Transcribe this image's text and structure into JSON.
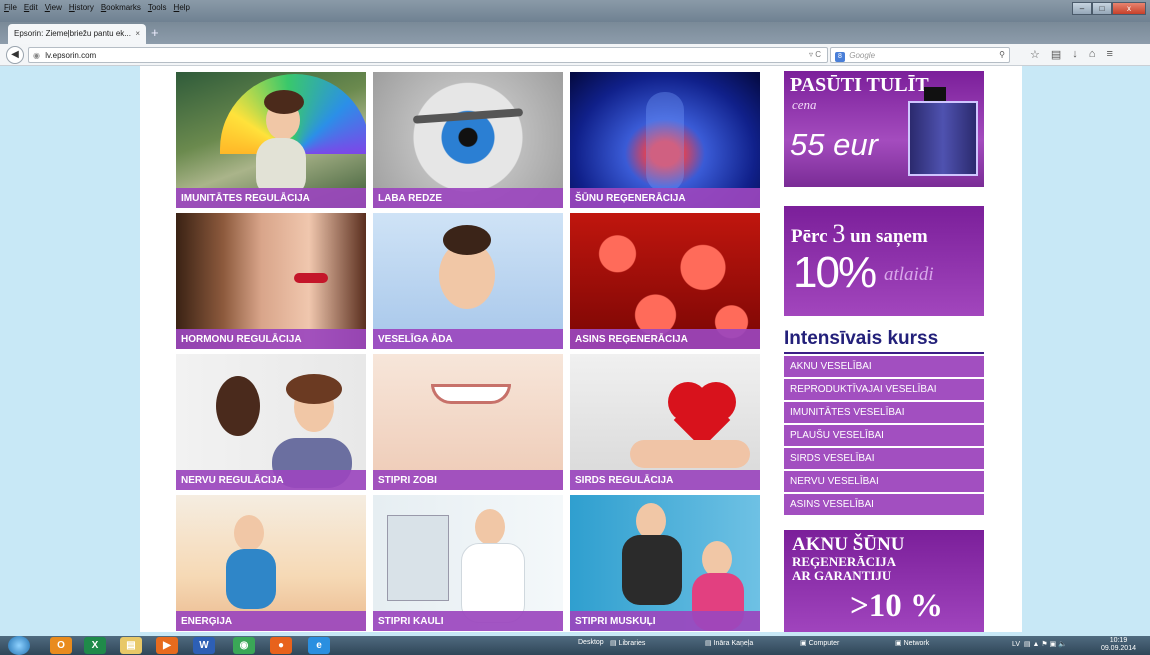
{
  "browser": {
    "menu": [
      "File",
      "Edit",
      "View",
      "History",
      "Bookmarks",
      "Tools",
      "Help"
    ],
    "tab_title": "Epsorin: Ziemeļbriežu pantu ek...",
    "tab_close": "×",
    "new_tab": "+",
    "url": "lv.epsorin.com",
    "url_controls": "▿ C",
    "search_placeholder": "Google",
    "search_engine_badge": "8",
    "window_controls": {
      "minimize": "–",
      "maximize": "□",
      "close": "x"
    }
  },
  "tiles": [
    {
      "label": "IMUNITĀTES REGULĀCIJA",
      "image": "rainbow-umbrella-woman"
    },
    {
      "label": "LABA REDZE",
      "image": "blue-eye"
    },
    {
      "label": "ŠŪNU REĢENERĀCIJA",
      "image": "blood-vessels"
    },
    {
      "label": "HORMONU REGULĀCIJA",
      "image": "couple-faces"
    },
    {
      "label": "VESELĪGA ĀDA",
      "image": "woman-clear-skin"
    },
    {
      "label": "ASINS REĢENERĀCIJA",
      "image": "red-blood-cells"
    },
    {
      "label": "NERVU REGULĀCIJA",
      "image": "women-shouting"
    },
    {
      "label": "STIPRI ZOBI",
      "image": "smiling-teeth"
    },
    {
      "label": "SIRDS REGULĀCIJA",
      "image": "heart-in-hand"
    },
    {
      "label": "ENERĢIJA",
      "image": "woman-running"
    },
    {
      "label": "STIPRI KAULI",
      "image": "doctor-xray"
    },
    {
      "label": "STIPRI MUSKUĻI",
      "image": "couple-gym"
    }
  ],
  "sidebar": {
    "promo_order": {
      "title": "PASŪTI TULĪT",
      "subtitle": "cena",
      "price": "55 eur"
    },
    "promo_discount": {
      "title_prefix": "Pērc",
      "title_number": "3",
      "title_suffix": "un saņem",
      "big": "10%",
      "italic": "atlaidi"
    },
    "course_heading": "Intensīvais kurss",
    "courses": [
      "AKNU VESELĪBAI",
      "REPRODUKTĪVAJAI VESELĪBAI",
      "IMUNITĀTES VESELĪBAI",
      "PLAUŠU VESELĪBAI",
      "SIRDS VESELĪBAI",
      "NERVU VESELĪBAI",
      "ASINS VESELĪBAI"
    ],
    "promo_liver": {
      "line1": "AKNU ŠŪNU",
      "line2": "REĢENERĀCIJA",
      "line3": "AR GARANTIJU",
      "percent": ">10 %"
    }
  },
  "taskbar": {
    "apps": [
      "outlook-icon",
      "excel-icon",
      "explorer-icon",
      "media-player-icon",
      "word-icon",
      "chrome-icon",
      "firefox-icon",
      "ie-icon"
    ],
    "desktop_label": "Desktop",
    "libraries_label": "Libraries",
    "user_label": "Ināra Kaņeļa",
    "computer_label": "Computer",
    "network_label": "Network",
    "lang": "LV",
    "time": "10:19",
    "date": "09.09.2014"
  },
  "colors": {
    "accent": "#9b46be",
    "heading": "#23207a",
    "page_bg": "#c8e8f6"
  }
}
